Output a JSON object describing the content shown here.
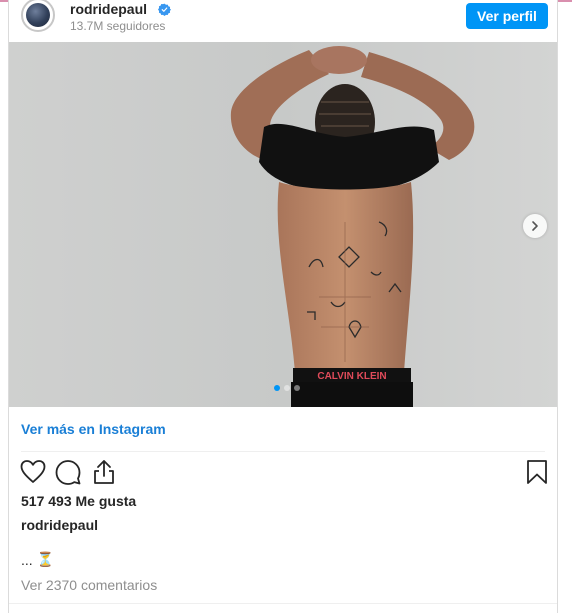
{
  "header": {
    "username": "rodridepaul",
    "followers": "13.7M seguidores",
    "profile_button": "Ver perfil"
  },
  "post": {
    "image_description": "shirtless man with tattoos pulling black shirt over head",
    "carousel": {
      "count": 3,
      "active": 1
    },
    "more_link": "Ver más en Instagram",
    "likes": "517 493 Me gusta",
    "caption_user": "rodridepaul",
    "caption_text": "...",
    "caption_emoji": "⏳",
    "comments_link": "Ver 2370 comentarios"
  },
  "colors": {
    "accent": "#0095f6",
    "link": "#1a7fd6",
    "muted": "#8e8e8e"
  },
  "icons": [
    "verified-badge-icon",
    "chevron-right-icon",
    "heart-icon",
    "comment-icon",
    "share-icon",
    "bookmark-icon",
    "hourglass-icon"
  ]
}
